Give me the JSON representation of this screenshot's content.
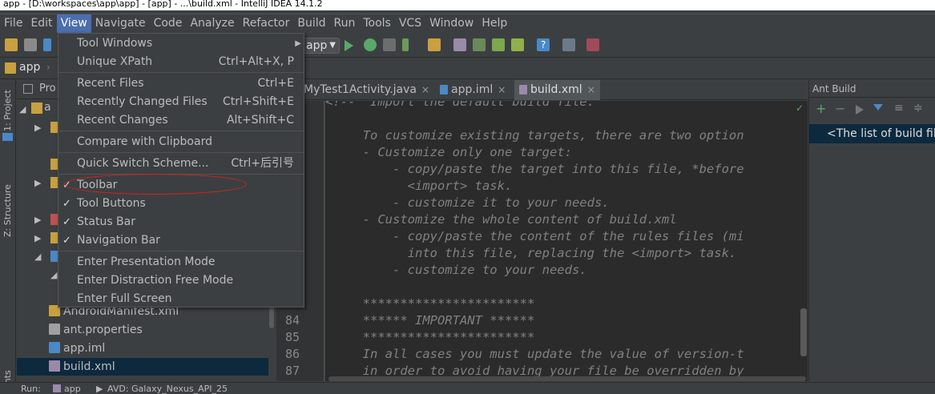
{
  "window": {
    "title": "app - [D:\\workspaces\\app\\app] - [app] - ...\\build.xml - IntelliJ IDEA 14.1.2"
  },
  "menubar": {
    "items": [
      "File",
      "Edit",
      "View",
      "Navigate",
      "Code",
      "Analyze",
      "Refactor",
      "Build",
      "Run",
      "Tools",
      "VCS",
      "Window",
      "Help"
    ],
    "active": "View"
  },
  "toolbar": {
    "run_config": "app"
  },
  "navbar": {
    "crumb": "app"
  },
  "leftstrip": {
    "project": "1: Project",
    "structure": "Z: Structure",
    "ants": "ants"
  },
  "project_panel": {
    "header": "Pro",
    "root_label": "a",
    "files": [
      "AndroidManifest.xml",
      "ant.properties",
      "app.iml",
      "build.xml"
    ],
    "selected": "build.xml"
  },
  "editor": {
    "tabs": [
      {
        "label": "MyTest1Activity.java"
      },
      {
        "label": "app.iml"
      },
      {
        "label": "build.xml"
      }
    ],
    "active_tab": "build.xml",
    "line_numbers": [
      "84",
      "85",
      "86",
      "87"
    ],
    "code_lines": [
      "<!--  Import the default build file.",
      "",
      "     To customize existing targets, there are two option",
      "     - Customize only one target:",
      "         - copy/paste the target into this file, *before",
      "           <import> task.",
      "         - customize it to your needs.",
      "     - Customize the whole content of build.xml",
      "         - copy/paste the content of the rules files (mi",
      "           into this file, replacing the <import> task.",
      "         - customize to your needs.",
      "",
      "     ***********************",
      "     ****** IMPORTANT ******",
      "     ***********************",
      "     In all cases you must update the value of version-t",
      "     in order to avoid having your file be overridden by"
    ]
  },
  "ant_panel": {
    "title": "Ant Build",
    "message": "<The list of build file"
  },
  "statusbar": {
    "run": "Run:",
    "app": "app",
    "avd": "AVD: Galaxy_Nexus_API_25"
  },
  "view_menu": {
    "items": [
      {
        "label": "Tool Windows",
        "shortcut": "",
        "submenu": true,
        "checked": false
      },
      {
        "label": "Unique XPath",
        "shortcut": "Ctrl+Alt+X, P",
        "checked": false
      },
      {
        "label": "Recent Files",
        "shortcut": "Ctrl+E",
        "checked": false
      },
      {
        "label": "Recently Changed Files",
        "shortcut": "Ctrl+Shift+E",
        "checked": false
      },
      {
        "label": "Recent Changes",
        "shortcut": "Alt+Shift+C",
        "checked": false
      },
      {
        "label": "Compare with Clipboard",
        "shortcut": "",
        "checked": false
      },
      {
        "label": "Quick Switch Scheme...",
        "shortcut": "Ctrl+后引号",
        "checked": false
      },
      {
        "label": "Toolbar",
        "shortcut": "",
        "checked": true
      },
      {
        "label": "Tool Buttons",
        "shortcut": "",
        "checked": true
      },
      {
        "label": "Status Bar",
        "shortcut": "",
        "checked": true
      },
      {
        "label": "Navigation Bar",
        "shortcut": "",
        "checked": true
      },
      {
        "label": "Enter Presentation Mode",
        "shortcut": "",
        "checked": false
      },
      {
        "label": "Enter Distraction Free Mode",
        "shortcut": "",
        "checked": false
      },
      {
        "label": "Enter Full Screen",
        "shortcut": "",
        "checked": false
      }
    ],
    "check_glyph": "✓",
    "submenu_glyph": "▶"
  },
  "colors": {
    "background": "#3c3f41",
    "editor": "#2b2b2b",
    "selection": "#4b6eaf",
    "annotation": "#e02020"
  }
}
